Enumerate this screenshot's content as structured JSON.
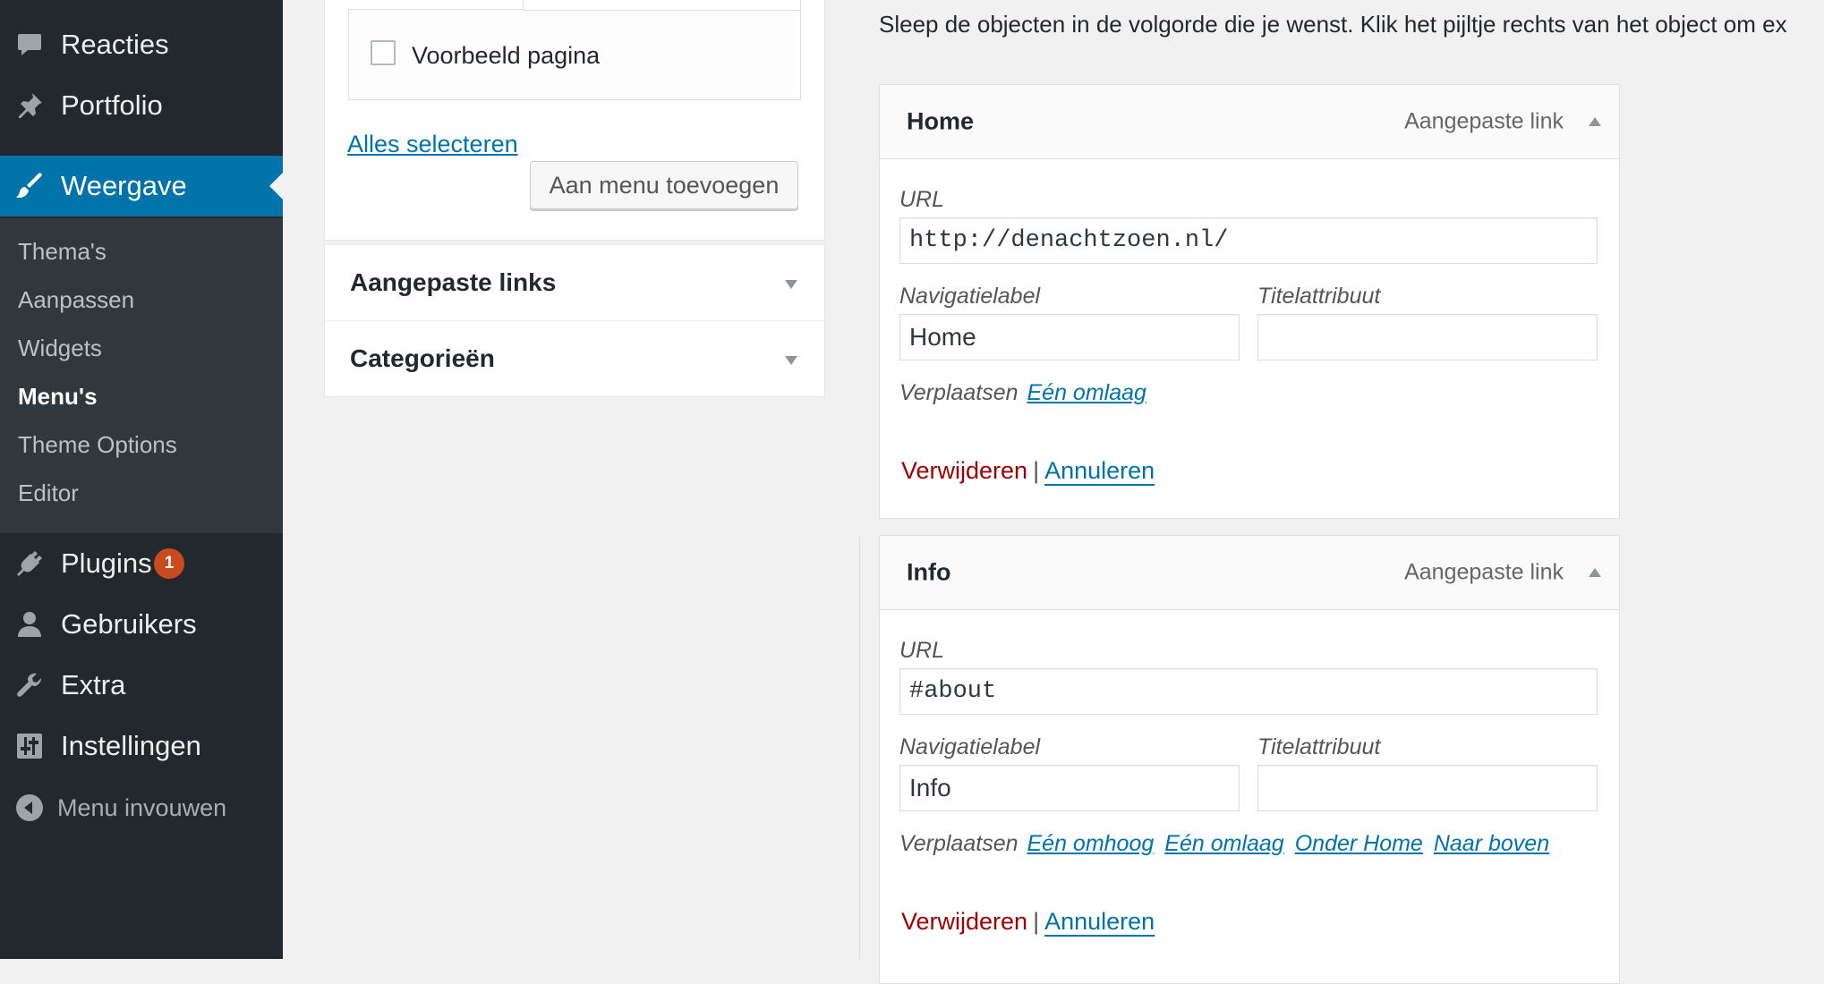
{
  "sidebar": {
    "items": [
      {
        "label": "Reacties",
        "icon": "comment-icon"
      },
      {
        "label": "Portfolio",
        "icon": "pin-icon"
      },
      {
        "label": "Weergave",
        "icon": "paintbrush-icon",
        "current": true
      },
      {
        "label": "Plugins",
        "icon": "plug-icon",
        "badge": "1"
      },
      {
        "label": "Gebruikers",
        "icon": "user-icon"
      },
      {
        "label": "Extra",
        "icon": "wrench-icon"
      },
      {
        "label": "Instellingen",
        "icon": "settings-sliders-icon"
      }
    ],
    "submenu": [
      "Thema's",
      "Aanpassen",
      "Widgets",
      "Menu's",
      "Theme Options",
      "Editor"
    ],
    "submenu_current": "Menu's",
    "collapse_label": "Menu invouwen"
  },
  "left_panel": {
    "checkbox_label": "Voorbeeld pagina",
    "select_all": "Alles selecteren",
    "add_button": "Aan menu toevoegen",
    "accordions": [
      "Aangepaste links",
      "Categorieën"
    ]
  },
  "structure": {
    "instructions": "Sleep de objecten in de volgorde die je wenst. Klik het pijltje rechts van het object om ex",
    "labels": {
      "url": "URL",
      "nav_label": "Navigatielabel",
      "title_attr": "Titelattribuut",
      "move": "Verplaatsen",
      "delete": "Verwijderen",
      "separator": "|",
      "cancel": "Annuleren"
    },
    "items": [
      {
        "title": "Home",
        "type": "Aangepaste link",
        "url": "http://denachtzoen.nl/",
        "nav_label": "Home",
        "title_attr": "",
        "move_links": [
          "Eén omlaag"
        ]
      },
      {
        "title": "Info",
        "type": "Aangepaste link",
        "url": "#about",
        "nav_label": "Info",
        "title_attr": "",
        "move_links": [
          "Eén omhoog",
          "Eén omlaag",
          "Onder Home",
          "Naar boven"
        ]
      }
    ]
  },
  "colors": {
    "sidebar_bg": "#23282d",
    "submenu_bg": "#32373c",
    "accent": "#0073aa",
    "badge": "#ca4a1f",
    "delete": "#a00000"
  }
}
